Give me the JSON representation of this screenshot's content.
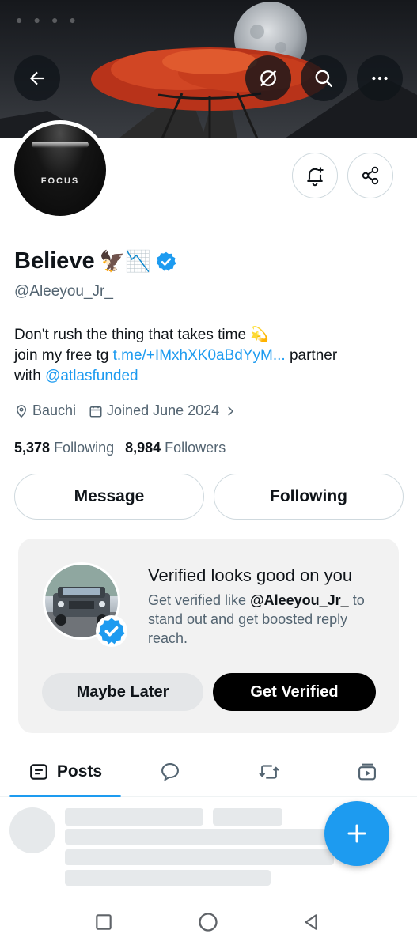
{
  "profile": {
    "avatar_text": "FOCUS",
    "name": "Believe",
    "name_emojis": "🦅📉",
    "handle": "@Aleeyou_Jr_",
    "bio_line1": "Don't rush the thing that takes time 💫",
    "bio_line2_prefix": "join my free tg ",
    "bio_link": "t.me/+IMxhXK0aBdYyM...",
    "bio_line2_suffix": " partner",
    "bio_line3_prefix": "with ",
    "bio_mention": "@atlasfunded",
    "location": "Bauchi",
    "joined": "Joined June 2024",
    "following_count": "5,378",
    "following_label": "Following",
    "followers_count": "8,984",
    "followers_label": "Followers"
  },
  "actions": {
    "message_label": "Message",
    "following_label": "Following"
  },
  "verify_card": {
    "title": "Verified looks good on you",
    "text_prefix": "Get verified like ",
    "text_handle": "@Aleeyou_Jr_",
    "text_suffix": " to stand out and get boosted reply reach.",
    "maybe_later_label": "Maybe Later",
    "get_verified_label": "Get Verified"
  },
  "tabs": {
    "posts_label": "Posts",
    "items": [
      "posts-icon",
      "replies-icon",
      "reposts-icon",
      "media-icon"
    ]
  },
  "icons": {
    "back": "back-arrow-icon",
    "no_grok": "slashed-circle-icon",
    "search": "search-icon",
    "more": "more-icon",
    "notify": "bell-plus-icon",
    "share": "share-icon",
    "verified": "verified-badge-icon",
    "location": "location-pin-icon",
    "calendar": "calendar-icon",
    "chevron": "chevron-right-icon",
    "compose": "plus-icon"
  },
  "colors": {
    "accent": "#1d9bf0",
    "text": "#0f1419",
    "muted": "#536471"
  }
}
